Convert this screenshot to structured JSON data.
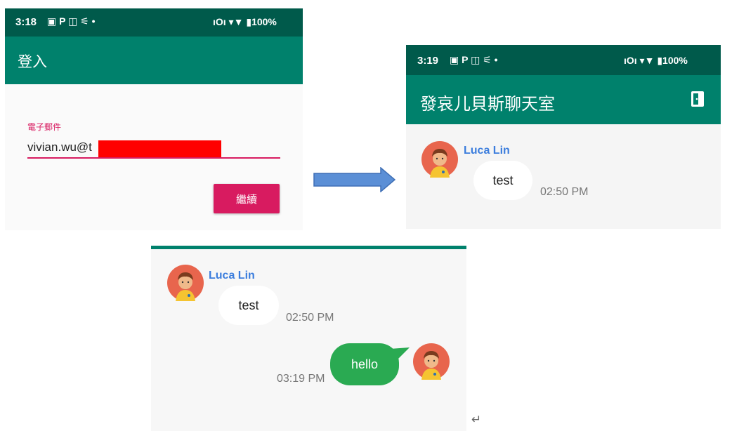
{
  "login": {
    "status": {
      "time": "3:18",
      "icons_left": "▣ P ◫ ⚟ •",
      "icons_right": "ıOı ▾▼ ▮100%"
    },
    "title": "登入",
    "email_label": "電子郵件",
    "email_value": "vivian.wu@t",
    "continue_label": "繼續"
  },
  "chat": {
    "status": {
      "time": "3:19",
      "icons_left": "▣ P ◫ ⚟ •",
      "icons_right": "ıOı ▾▼ ▮100%"
    },
    "title": "發哀儿貝斯聊天室",
    "messages": [
      {
        "sender": "Luca Lin",
        "text": "test",
        "time": "02:50 PM"
      }
    ]
  },
  "detail": {
    "messages": [
      {
        "sender": "Luca Lin",
        "text": "test",
        "time": "02:50 PM",
        "direction": "incoming"
      },
      {
        "sender": "",
        "text": "hello",
        "time": "03:19 PM",
        "direction": "outgoing"
      }
    ]
  },
  "return_glyph": "↵",
  "colors": {
    "status_bar": "#005a4b",
    "app_bar": "#00816c",
    "accent": "#d81b60",
    "sender_name": "#3b7ddd",
    "outgoing_bubble": "#2aaa52",
    "arrow": "#5b8fd6"
  },
  "icons": [
    "exit-door-icon",
    "avatar-icon",
    "arrow-right-icon"
  ]
}
